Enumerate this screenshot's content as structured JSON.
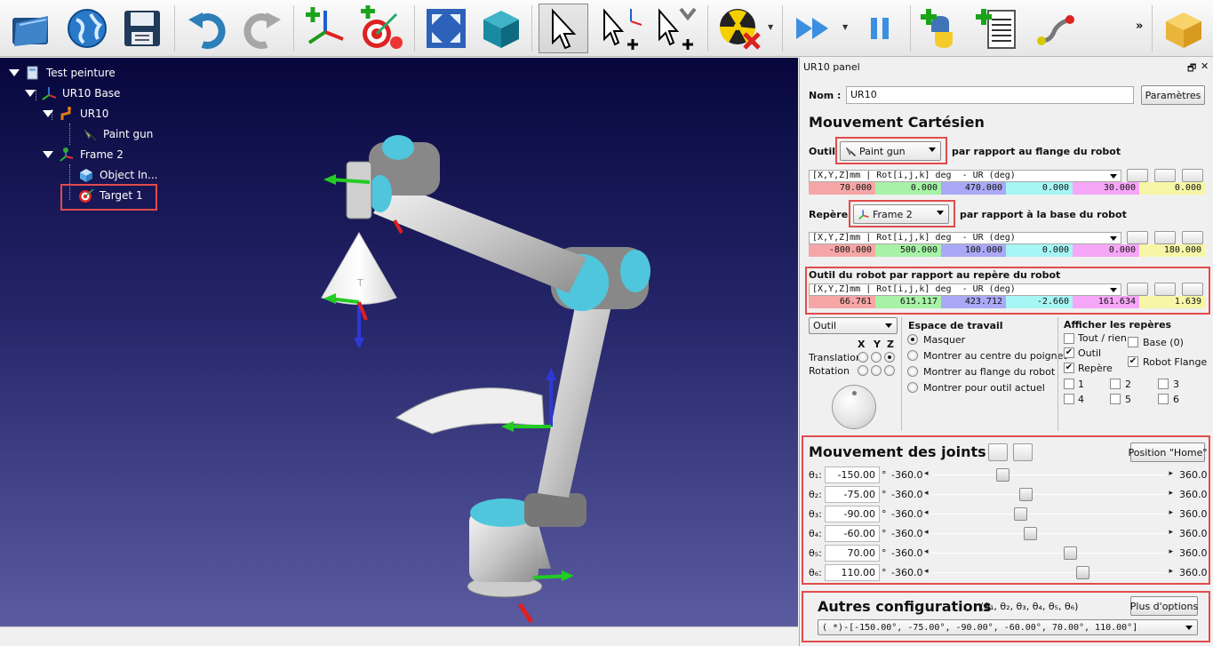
{
  "toolbar": {
    "buttons": [
      {
        "name": "open-folder-icon"
      },
      {
        "name": "globe-icon"
      },
      {
        "name": "save-icon"
      },
      {
        "name": "undo-icon"
      },
      {
        "name": "redo-icon"
      },
      {
        "name": "add-frame-icon"
      },
      {
        "name": "add-target-icon"
      },
      {
        "name": "fit-view-icon"
      },
      {
        "name": "3d-view-icon"
      },
      {
        "name": "select-pointer-icon"
      },
      {
        "name": "move-frame-icon"
      },
      {
        "name": "move-robot-icon"
      },
      {
        "name": "collision-icon"
      },
      {
        "name": "fast-forward-icon"
      },
      {
        "name": "pause-icon"
      },
      {
        "name": "add-python-icon"
      },
      {
        "name": "add-program-icon"
      },
      {
        "name": "path-icon"
      },
      {
        "name": "package-icon"
      }
    ],
    "more": "»"
  },
  "tree": {
    "items": [
      {
        "label": "Test peinture"
      },
      {
        "label": "UR10 Base"
      },
      {
        "label": "UR10"
      },
      {
        "label": "Paint gun"
      },
      {
        "label": "Frame 2"
      },
      {
        "label": "Object In..."
      },
      {
        "label": "Target 1"
      }
    ]
  },
  "panel": {
    "title": "UR10 panel",
    "name_label": "Nom :",
    "name_value": "UR10",
    "params_button": "Paramètres",
    "cart_heading": "Mouvement Cartésien",
    "tool_label": "Outil",
    "tool_value": "Paint gun",
    "tool_suffix": "par rapport au flange du robot",
    "format": "[X,Y,Z]mm | Rot[i,j,k] deg  - UR (deg)",
    "tool_values": [
      "70.000",
      "0.000",
      "470.000",
      "0.000",
      "30.000",
      "0.000"
    ],
    "ref_label": "Repère",
    "ref_value": "Frame 2",
    "ref_suffix": "par rapport à la base du robot",
    "ref_values": [
      "-800.000",
      "500.000",
      "100.000",
      "0.000",
      "0.000",
      "180.000"
    ],
    "robot_tool_label": "Outil du robot par rapport au repère du robot",
    "robot_tool_values": [
      "66.761",
      "615.117",
      "423.712",
      "-2.660",
      "161.634",
      "1.639"
    ],
    "cell_colors": [
      "#f6a6a6",
      "#a6f2a6",
      "#a9a9f6",
      "#a6f6f6",
      "#f6a6f6",
      "#f6f6a6"
    ],
    "mode_value": "Outil",
    "xyz": [
      "X",
      "Y",
      "Z"
    ],
    "translation": "Translation",
    "rotation": "Rotation",
    "workspace_title": "Espace de travail",
    "workspace_options": [
      "Masquer",
      "Montrer au centre du poignet",
      "Montrer au flange du robot",
      "Montrer pour outil actuel"
    ],
    "frames_title": "Afficher les repères",
    "frames": {
      "all": "Tout / rien",
      "base": "Base (0)",
      "tool": "Outil",
      "flange": "Robot Flange",
      "ref": "Repère",
      "nums": [
        "1",
        "2",
        "3",
        "4",
        "5",
        "6"
      ]
    },
    "joints_heading": "Mouvement des joints",
    "home_button": "Position \"Home\"",
    "joints": [
      {
        "label": "θ₁:",
        "value": "-150.00",
        "min": "-360.0",
        "max": "360.0",
        "frac": 0.2917
      },
      {
        "label": "θ₂:",
        "value": "-75.00",
        "min": "-360.0",
        "max": "360.0",
        "frac": 0.3958
      },
      {
        "label": "θ₃:",
        "value": "-90.00",
        "min": "-360.0",
        "max": "360.0",
        "frac": 0.375
      },
      {
        "label": "θ₄:",
        "value": "-60.00",
        "min": "-360.0",
        "max": "360.0",
        "frac": 0.4167
      },
      {
        "label": "θ₅:",
        "value": "70.00",
        "min": "-360.0",
        "max": "360.0",
        "frac": 0.5972
      },
      {
        "label": "θ₆:",
        "value": "110.00",
        "min": "-360.0",
        "max": "360.0",
        "frac": 0.6528
      }
    ],
    "degree_sign": "°",
    "configs_heading": "Autres configurations",
    "configs_sub": "(θ₁, θ₂, θ₃, θ₄, θ₅, θ₆)",
    "more_options_button": "Plus d'options",
    "config_value": "( *)-[-150.00°,  -75.00°,  -90.00°,  -60.00°,   70.00°,  110.00°]"
  }
}
